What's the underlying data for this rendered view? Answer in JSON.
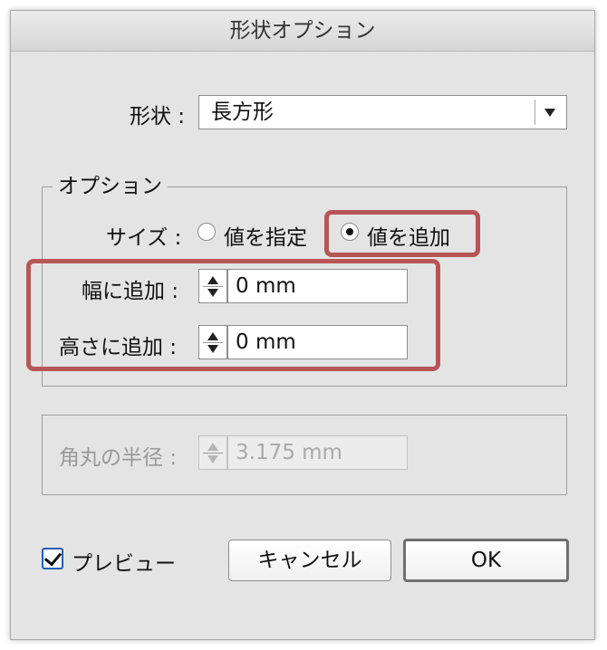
{
  "window": {
    "title": "形状オプション"
  },
  "shape": {
    "label": "形状 :",
    "value": "長方形"
  },
  "options_group": {
    "legend": "オプション",
    "size_label": "サイズ :",
    "radio_value": "値を指定",
    "radio_add": "値を追加",
    "radio_selected": "値を追加",
    "width_label": "幅に追加 :",
    "width_value": "0 mm",
    "height_label": "高さに追加 :",
    "height_value": "0 mm"
  },
  "corner": {
    "label": "角丸の半径 :",
    "value": "3.175 mm",
    "disabled": true
  },
  "preview": {
    "label": "プレビュー",
    "checked": true
  },
  "buttons": {
    "cancel": "キャンセル",
    "ok": "OK"
  },
  "colors": {
    "highlight": "#b85555",
    "checkbox_border": "#1f5fb8",
    "dialog_bg": "#e4e4e4"
  }
}
